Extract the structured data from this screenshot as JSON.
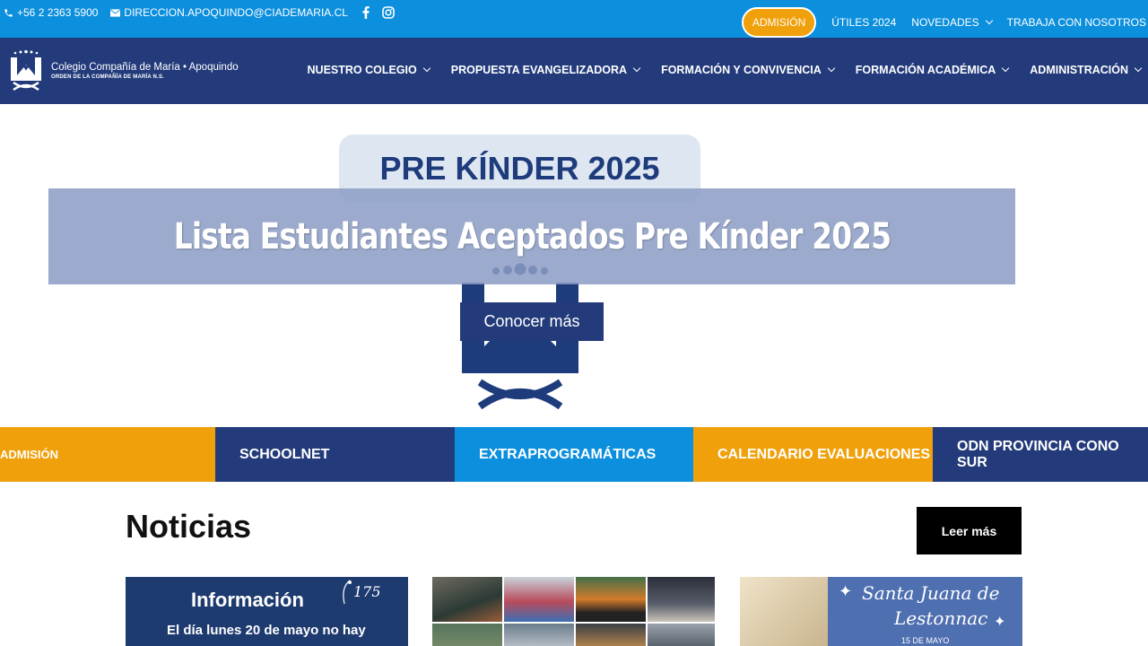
{
  "topbar": {
    "phone": "+56 2 2363 5900",
    "email": "DIRECCION.APOQUINDO@CIADEMARIA.CL",
    "admision_label": "ADMISIÓN",
    "links": [
      "ÚTILES 2024",
      "NOVEDADES",
      "TRABAJA CON NOSOTROS"
    ],
    "colors": {
      "background": "#0c8fdd",
      "accent": "#f0a00a"
    }
  },
  "header": {
    "logo_title": "Colegio Compañía de María • Apoquindo",
    "logo_subtitle": "ORDEN DE LA COMPAÑÍA DE MARÍA N.S.",
    "nav": [
      "NUESTRO COLEGIO",
      "PROPUESTA EVANGELIZADORA",
      "FORMACIÓN Y CONVIVENCIA",
      "FORMACIÓN ACADÉMICA",
      "ADMINISTRACIÓN"
    ],
    "colors": {
      "background": "#233b7b"
    }
  },
  "hero": {
    "badge": "PRE KÍNDER 2025",
    "title": "Lista Estudiantes Aceptados Pre Kínder 2025",
    "button": "Conocer más"
  },
  "quicklinks": [
    "ADMISIÓN",
    "SCHOOLNET",
    "EXTRAPROGRAMÁTICAS",
    "CALENDARIO EVALUACIONES",
    "ODN PROVINCIA CONO SUR"
  ],
  "news": {
    "title": "Noticias",
    "more_button": "Leer más",
    "card1": {
      "heading": "Información",
      "text": "El día lunes 20 de mayo no hay"
    },
    "card3": {
      "line1": "Santa Juana de",
      "line2": "Lestonnac",
      "line3": "15 DE MAYO"
    }
  }
}
